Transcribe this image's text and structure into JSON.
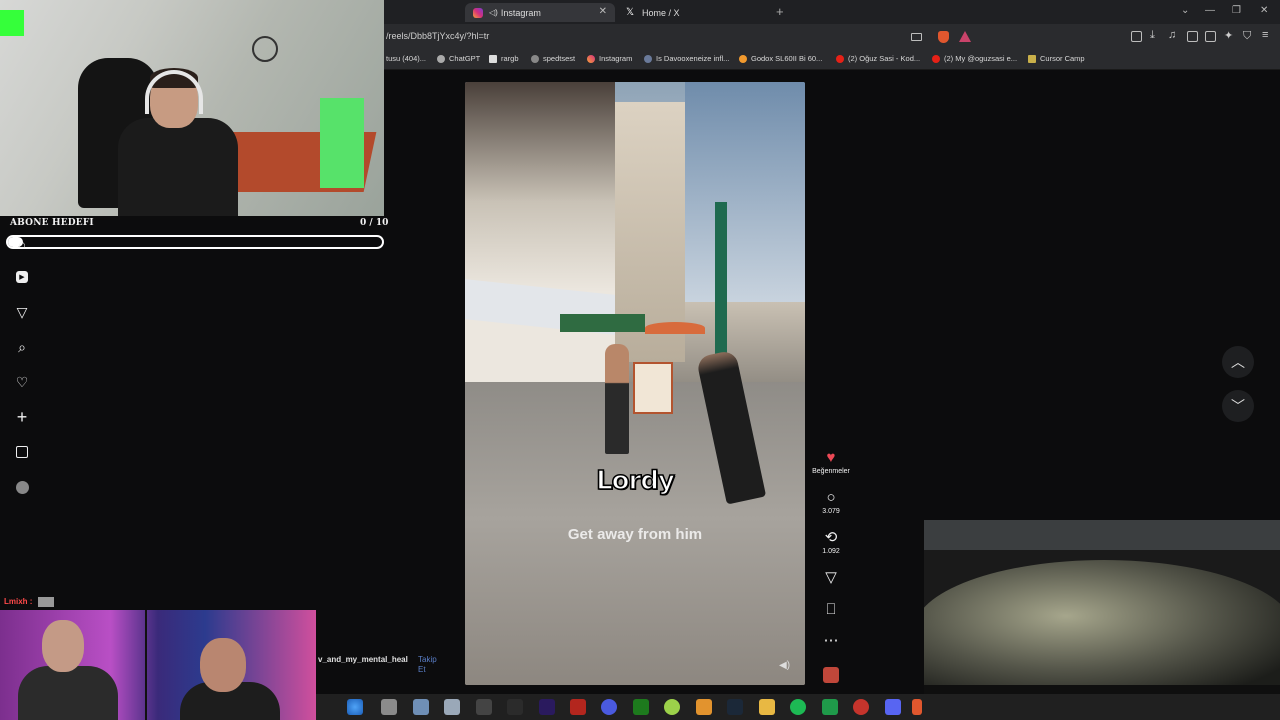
{
  "browser": {
    "tabs": [
      {
        "label": "Instagram",
        "active": true
      },
      {
        "label": "Home / X",
        "active": false
      }
    ],
    "new_tab_symbol": "+",
    "url": "/reels/Dbb8TjYxc4y/?hl=tr",
    "bookmarks": [
      "tusu (404)...",
      "ChatGPT",
      "rargb",
      "spedtsest",
      "Instagram",
      "Is Davooxeneize infl...",
      "Godox SL60II Bi 60...",
      "(2) Oğuz Sasi - Kod...",
      "(2) My @oguzsasi e...",
      "Cursor Camp"
    ]
  },
  "stream_overlay": {
    "goal_label": "ABONE HEDEFI",
    "goal_count": "0 / 10",
    "goal_progress": 0.04,
    "chat_user": "Lmixh :"
  },
  "reel": {
    "overlay_name": "Lordy",
    "caption": "Get away from him",
    "username": "v_and_my_mental_heal",
    "follow_label": "Takip Et"
  },
  "actions": {
    "like_label": "Beğenmeler",
    "comments": "3.079",
    "reposts": "1.092"
  },
  "icons": {
    "side_nav": [
      "home-icon",
      "reels-icon",
      "send-icon",
      "search-icon",
      "heart-icon",
      "plus-icon",
      "stats-icon",
      "profile-icon"
    ],
    "accent": "#ed4956"
  }
}
